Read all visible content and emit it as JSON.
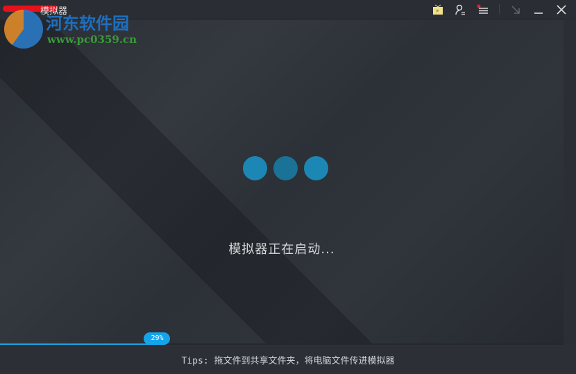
{
  "window": {
    "title": "模拟器"
  },
  "toolbar": {
    "icons": [
      "tv-icon",
      "user-settings-icon",
      "menu-icon",
      "restore-icon",
      "minimize-icon",
      "close-icon"
    ],
    "notification_color": "#e0203a"
  },
  "main": {
    "status": "模拟器正在启动...",
    "loading_dot_color": "#1c87b4"
  },
  "progress": {
    "percent": 29,
    "label": "29%"
  },
  "footer": {
    "tips": "Tips: 拖文件到共享文件夹，将电脑文件传进模拟器"
  },
  "watermark": {
    "name": "河东软件园",
    "url": "www.pc0359.cn"
  }
}
